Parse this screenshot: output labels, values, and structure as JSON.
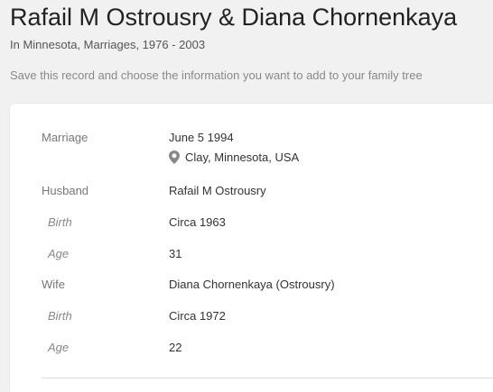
{
  "header": {
    "title": "Rafail M Ostrousry & Diana Chornenkaya",
    "subtitle": "In Minnesota, Marriages, 1976 - 2003",
    "save_prompt": "Save this record and choose the information you want to add to your family tree"
  },
  "record": {
    "marriage_label": "Marriage",
    "marriage_date": "June 5 1994",
    "marriage_place": "Clay, Minnesota, USA",
    "husband_label": "Husband",
    "husband_name": "Rafail M Ostrousry",
    "husband_birth_label": "Birth",
    "husband_birth": "Circa 1963",
    "husband_age_label": "Age",
    "husband_age": "31",
    "wife_label": "Wife",
    "wife_name": "Diana Chornenkaya (Ostrousry)",
    "wife_birth_label": "Birth",
    "wife_birth": "Circa 1972",
    "wife_age_label": "Age",
    "wife_age": "22"
  },
  "icons": {
    "place": "map-pin-icon"
  },
  "colors": {
    "background": "#f1f1f1",
    "card": "#ffffff",
    "label": "#777777"
  }
}
